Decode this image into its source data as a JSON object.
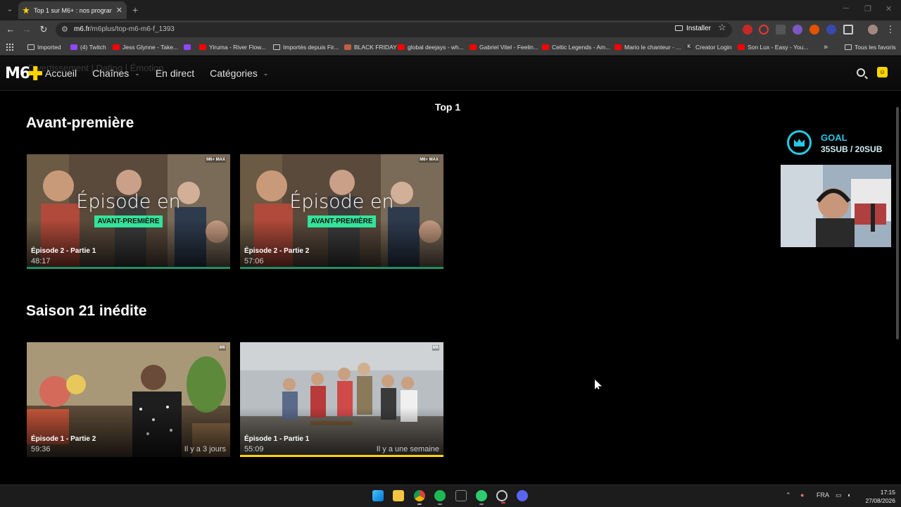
{
  "browser": {
    "tab_title": "Top 1 sur M6+ : nos programmes",
    "new_tab_symbol": "+",
    "url_host": "m6.fr",
    "url_path": "/m6plus/top-m6-m6-f_1393",
    "install_label": "Installer",
    "bookmarks": [
      {
        "label": "Imported",
        "icon": "folder-icon"
      },
      {
        "label": "(4) Twitch",
        "icon": "twitch-icon"
      },
      {
        "label": "Jess Glynne - Take...",
        "icon": "youtube-icon"
      },
      {
        "label": "",
        "icon": "twitch-icon"
      },
      {
        "label": "Yiruma - River Flow...",
        "icon": "youtube-icon"
      },
      {
        "label": "Importés depuis Fir...",
        "icon": "folder-icon"
      },
      {
        "label": "BLACK FRIDAY",
        "icon": "shop-icon"
      },
      {
        "label": "global deejays - wh...",
        "icon": "youtube-icon"
      },
      {
        "label": "Gabriel Vitel - Feelin...",
        "icon": "youtube-icon"
      },
      {
        "label": "Celtic Legends - Am...",
        "icon": "youtube-icon"
      },
      {
        "label": "Mario le chanteur - ...",
        "icon": "youtube-icon"
      },
      {
        "label": "Creator Login",
        "icon": "kick-icon"
      },
      {
        "label": "Son Lux - Easy - You...",
        "icon": "youtube-icon"
      }
    ],
    "more_bookmarks": "»",
    "all_favorites": "Tous les favoris"
  },
  "site": {
    "ghost_text": "Divertissement | Dating | Émotion",
    "nav": {
      "home": "Accueil",
      "channels": "Chaînes",
      "live": "En direct",
      "categories": "Catégories"
    },
    "page_title": "Top 1",
    "sections": [
      {
        "title": "Avant-première",
        "cards": [
          {
            "episode": "Épisode 2 - Partie 1",
            "duration": "48:17",
            "overlay": "Épisode en",
            "tag": "AVANT-PREMIÈRE",
            "badge": "M6+ MAX",
            "progress_color": "#1f8f6a"
          },
          {
            "episode": "Épisode 2 - Partie 2",
            "duration": "57:06",
            "overlay": "Épisode en",
            "tag": "AVANT-PREMIÈRE",
            "badge": "M6+ MAX",
            "progress_color": "#1f8f6a"
          }
        ]
      },
      {
        "title": "Saison 21 inédite",
        "cards": [
          {
            "episode": "Épisode 1 - Partie 2",
            "duration": "59:36",
            "ago": "Il y a 3 jours",
            "badge": "M6"
          },
          {
            "episode": "Épisode 1 - Partie 1",
            "duration": "55:09",
            "ago": "Il y a une semaine",
            "badge": "M6",
            "progress_color": "#ffd400"
          }
        ]
      }
    ]
  },
  "overlay": {
    "goal_label": "GOAL",
    "goal_value": "35SUB / 20SUB"
  },
  "taskbar": {
    "language": "FRA",
    "time": "17:15",
    "date": "27/08/2026"
  }
}
